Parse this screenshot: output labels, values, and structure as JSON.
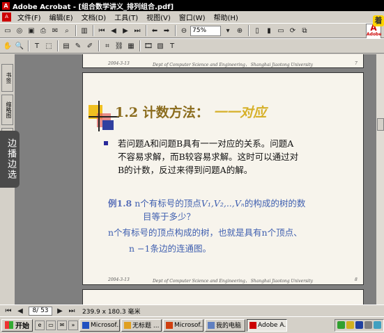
{
  "window": {
    "title": "Adobe Acrobat - [组合数学讲义_排列组合.pdf]",
    "app_icon": "acrobat-icon"
  },
  "menu": {
    "items": [
      "文件(F)",
      "编辑(E)",
      "文档(D)",
      "工具(T)",
      "视图(V)",
      "窗口(W)",
      "帮助(H)"
    ]
  },
  "toolbar": {
    "zoom_value": "75%"
  },
  "sidebar": {
    "tabs": [
      "书签",
      "缩略图",
      "批注"
    ]
  },
  "frame_button": {
    "label": "边播边选"
  },
  "page_prev": {
    "footer_date": "2004-3-13",
    "footer_dept": "Dept of Computer Science and Engineering，  Shanghai Jiaotong University",
    "footer_num": "7"
  },
  "slide": {
    "section_title": "1.2 计数方法：",
    "section_title_accent": "一一对应",
    "bullet_line1": "若问题A和问题B具有一一对应的关系。问题A",
    "bullet_line2": "不容易求解，而B较容易求解。这时可以通过对",
    "bullet_line3": "B的计数，反过来得到问题A的解。",
    "example_label": "例1.8",
    "example_line1_a": "n个有标号的顶点",
    "example_line1_vars": "V₁,V₂,..,Vₙ",
    "example_line1_b": "的构成的树的数",
    "example_line2": "目等于多少？",
    "answer_line1": "n个有标号的顶点构成的树，也就是具有n个顶点、",
    "answer_line2": "n −1条边的连通图。",
    "footer_date": "2004-3-13",
    "footer_dept": "Dept of Computer Science and Engineering，  Shanghai Jiaotong University",
    "footer_num": "8"
  },
  "status": {
    "page": "8/ 53",
    "size": "239.9 x 180.3 毫米"
  },
  "taskbar": {
    "start": "开始",
    "items": [
      {
        "label": "Microsof...",
        "active": false
      },
      {
        "label": "无标题 ...",
        "active": false
      },
      {
        "label": "Microsof...",
        "active": false
      },
      {
        "label": "我的电脑",
        "active": false
      },
      {
        "label": "Adobe A...",
        "active": true
      }
    ]
  },
  "colors": {
    "accent_title": "#8b6c1e",
    "accent_blue": "#4060b0",
    "bullet": "#2a2a9a"
  }
}
